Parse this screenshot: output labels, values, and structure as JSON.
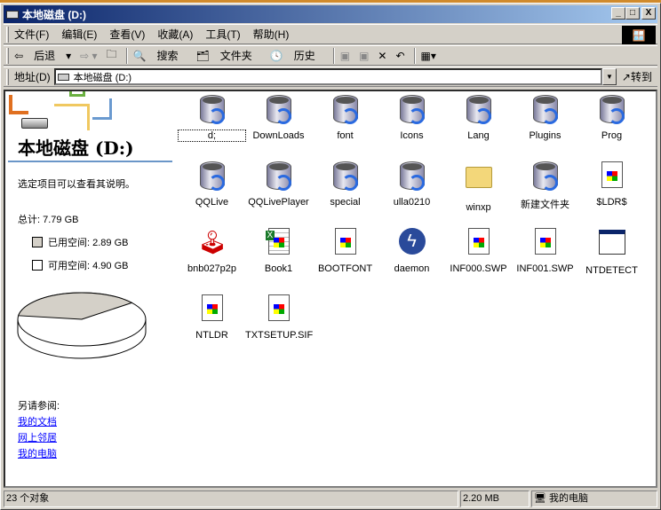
{
  "window": {
    "title": "本地磁盘 (D:)",
    "min": "_",
    "max": "□",
    "close": "X"
  },
  "menu": [
    "文件(F)",
    "编辑(E)",
    "查看(V)",
    "收藏(A)",
    "工具(T)",
    "帮助(H)"
  ],
  "toolbar": {
    "back": "后退",
    "search": "搜索",
    "folders": "文件夹",
    "history": "历史"
  },
  "address": {
    "label": "地址(D)",
    "value": "本地磁盘 (D:)",
    "go": "转到"
  },
  "left": {
    "title": "本地磁盘 (D:)",
    "hint": "选定项目可以查看其说明。",
    "total": "总计: 7.79 GB",
    "used": "已用空间: 2.89 GB",
    "free": "可用空间: 4.90 GB",
    "used_fraction": 0.371,
    "used_color": "#d4d0c8",
    "see_also": "另请参阅:",
    "links": [
      "我的文档",
      "网上邻居",
      "我的电脑"
    ]
  },
  "items": [
    {
      "name": "d;",
      "icon": "drive-folder-icon"
    },
    {
      "name": "DownLoads",
      "icon": "drive-folder-icon"
    },
    {
      "name": "font",
      "icon": "drive-folder-icon"
    },
    {
      "name": "Icons",
      "icon": "drive-folder-icon"
    },
    {
      "name": "Lang",
      "icon": "drive-folder-icon"
    },
    {
      "name": "Plugins",
      "icon": "drive-folder-icon"
    },
    {
      "name": "Prog",
      "icon": "drive-folder-icon"
    },
    {
      "name": "QQLive",
      "icon": "drive-folder-icon"
    },
    {
      "name": "QQLivePlayer",
      "icon": "drive-folder-icon"
    },
    {
      "name": "special",
      "icon": "drive-folder-icon"
    },
    {
      "name": "ulla0210",
      "icon": "drive-folder-icon"
    },
    {
      "name": "winxp",
      "icon": "folder-icon"
    },
    {
      "name": "新建文件夹",
      "icon": "drive-folder-icon"
    },
    {
      "name": "$LDR$",
      "icon": "system-file-icon"
    },
    {
      "name": "bnb027p2p",
      "icon": "joystick-icon"
    },
    {
      "name": "Book1",
      "icon": "excel-icon"
    },
    {
      "name": "BOOTFONT",
      "icon": "system-file-icon"
    },
    {
      "name": "daemon",
      "icon": "daemon-icon"
    },
    {
      "name": "INF000.SWP",
      "icon": "system-file-icon"
    },
    {
      "name": "INF001.SWP",
      "icon": "system-file-icon"
    },
    {
      "name": "NTDETECT",
      "icon": "application-icon"
    },
    {
      "name": "NTLDR",
      "icon": "system-file-icon"
    },
    {
      "name": "TXTSETUP.SIF",
      "icon": "system-file-icon"
    }
  ],
  "status": {
    "count": "23 个对象",
    "size": "2.20 MB",
    "zone": "我的电脑"
  }
}
